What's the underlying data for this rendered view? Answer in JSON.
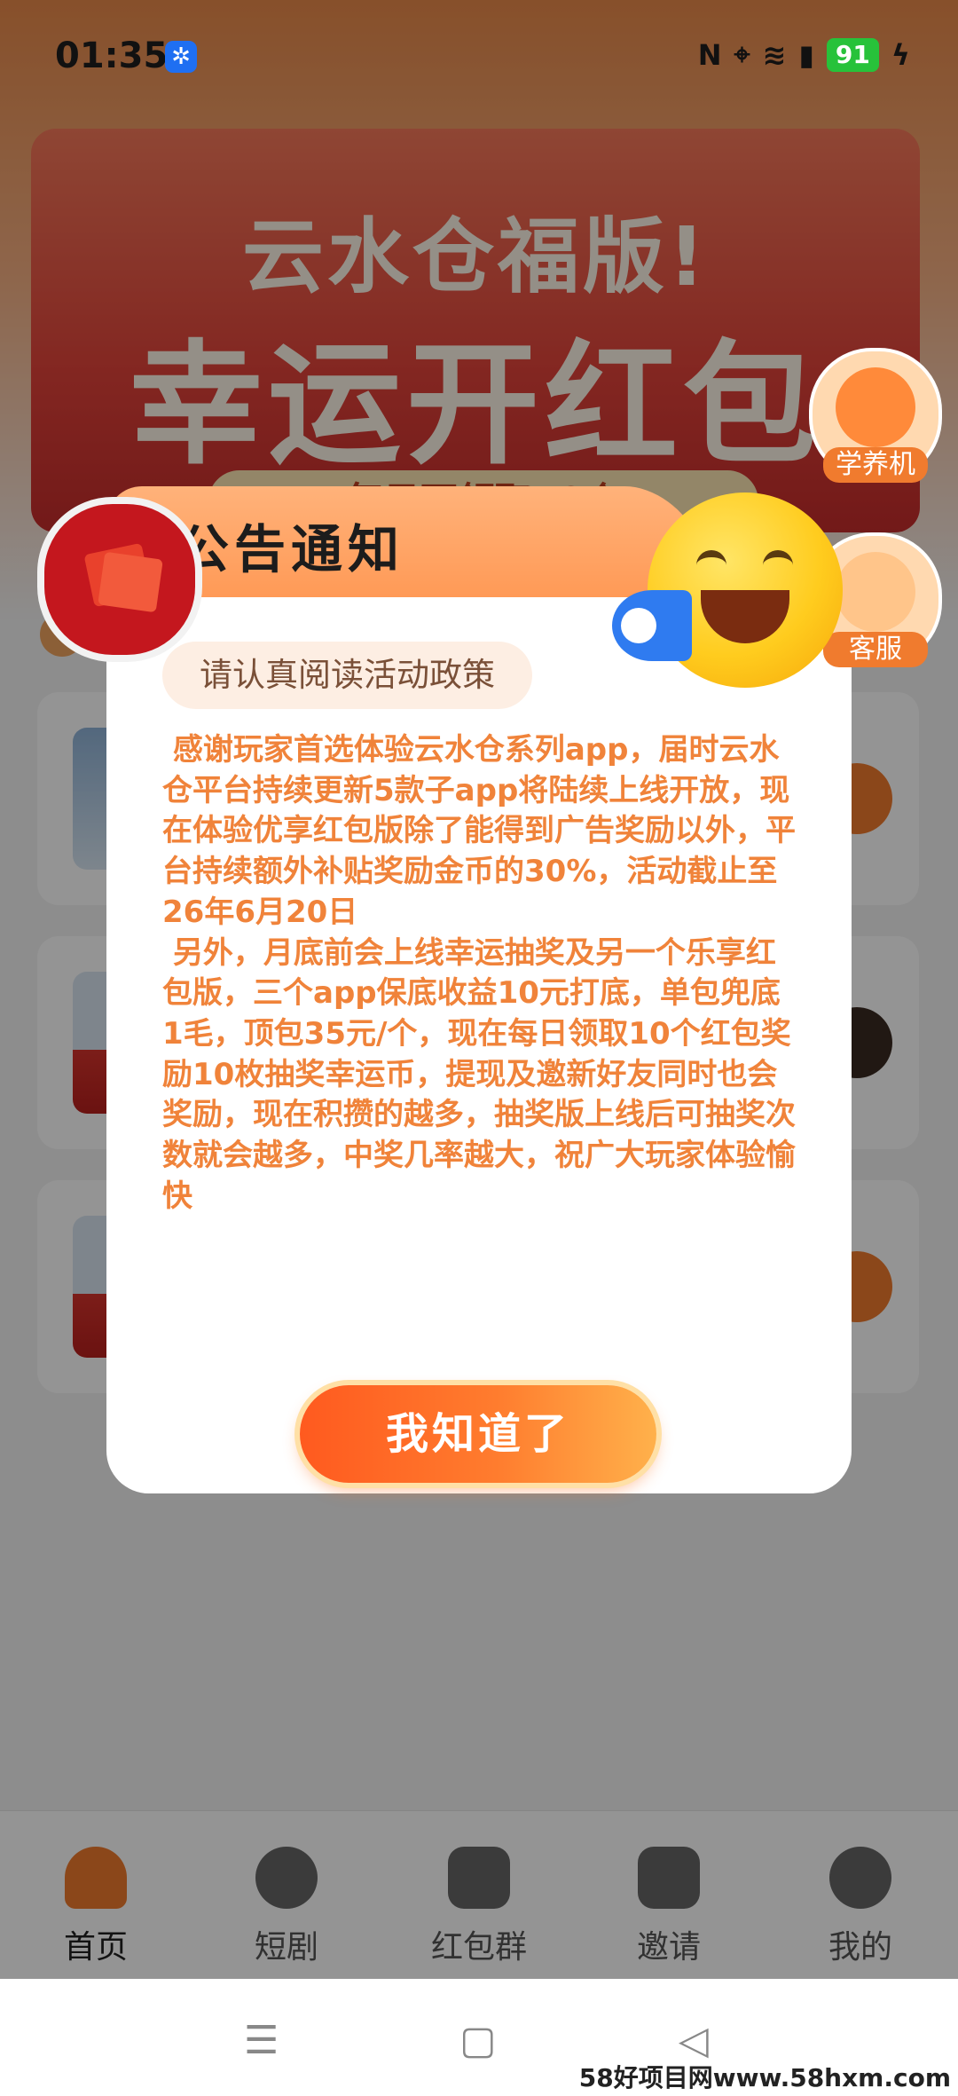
{
  "status_bar": {
    "time": "01:35",
    "icons": [
      "nfc-icon",
      "location-icon",
      "wifi-icon",
      "signal-4g-icon",
      "charging-icon"
    ],
    "battery": "91"
  },
  "banner": {
    "line1": "云水仓福版!",
    "line2": "幸运开红包",
    "line3": "每日可领取50个"
  },
  "floating": {
    "study": "学养机",
    "service": "客服"
  },
  "dialog": {
    "title": "公告通知",
    "subtitle": "请认真阅读活动政策",
    "body": " 感谢玩家首选体验云水仓系列app，届时云水仓平台持续更新5款子app将陆续上线开放，现在体验优享红包版除了能得到广告奖励以外，平台持续额外补贴奖励金币的30%，活动截止至26年6月20日\n 另外，月底前会上线幸运抽奖及另一个乐享红包版，三个app保底收益10元打底，单包兜底1毛，顶包35元/个，现在每日领取10个红包奖励10枚抽奖幸运币，提现及邀新好友同时也会奖励，现在积攒的越多，抽奖版上线后可抽奖次数就会越多，中奖几率越大，祝广大玩家体验愉快",
    "ok_button": "我知道了"
  },
  "tabs": [
    {
      "label": "首页",
      "icon": "home-icon"
    },
    {
      "label": "短剧",
      "icon": "film-reel-icon"
    },
    {
      "label": "红包群",
      "icon": "red-envelope-icon"
    },
    {
      "label": "邀请",
      "icon": "gift-icon"
    },
    {
      "label": "我的",
      "icon": "profile-icon"
    }
  ],
  "watermark": "58好项目网www.58hxm.com",
  "colors": {
    "accent": "#f07b2e",
    "dialog_text": "#f0833a",
    "button_start": "#ff5a1f",
    "button_end": "#ffb14b"
  }
}
